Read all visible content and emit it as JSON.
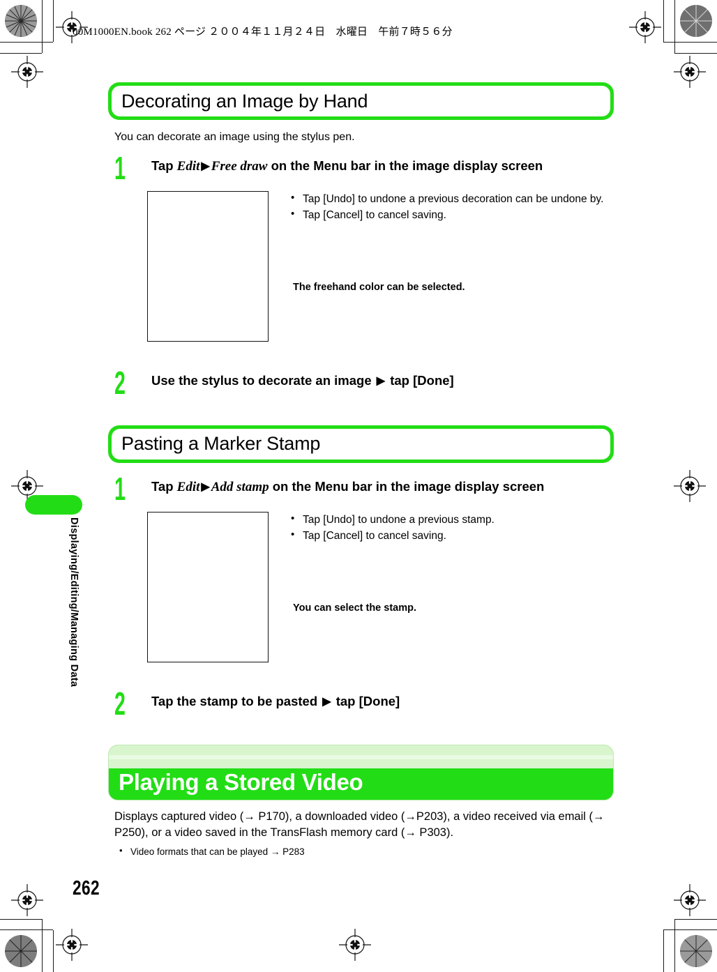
{
  "page": {
    "file_header": "00M1000EN.book   262 ページ   ２００４年１１月２４日　水曜日　午前７時５６分",
    "page_number": "262",
    "sidebar_label": "Displaying/Editing/Managing Data",
    "accent_green": "#22dd15",
    "light_green": "#d8f5ce"
  },
  "sections": [
    {
      "heading": "Decorating an Image by Hand",
      "intro": "You can decorate an image using the stylus pen.",
      "steps": [
        {
          "number": "1",
          "text_prefix": "Tap ",
          "italic_1": "Edit",
          "arrow": "▶",
          "italic_2": "Free draw",
          "text_suffix": " on the Menu bar in the image display screen"
        },
        {
          "number": "2",
          "text_prefix": "Use the stylus to decorate an image ",
          "arrow": "▶",
          "text_suffix": " tap [Done]"
        }
      ],
      "figure_notes": [
        "Tap [Undo] to undone a previous decoration can be undone by.",
        "Tap [Cancel] to cancel saving."
      ],
      "figure_caption": "The freehand color can be selected."
    },
    {
      "heading": "Pasting a Marker Stamp",
      "steps": [
        {
          "number": "1",
          "text_prefix": "Tap ",
          "italic_1": "Edit",
          "arrow": "▶",
          "italic_2": "Add stamp",
          "text_suffix": " on the Menu bar in the image display screen"
        },
        {
          "number": "2",
          "text_prefix": "Tap the stamp to be pasted ",
          "arrow": "▶",
          "text_suffix": " tap [Done]"
        }
      ],
      "figure_notes": [
        "Tap [Undo] to undone a previous stamp.",
        "Tap [Cancel] to cancel saving."
      ],
      "figure_caption": "You can select the stamp."
    }
  ],
  "chapter": {
    "banner_title": "Playing a Stored Video",
    "body": "Displays captured video (→ P170), a downloaded video (→P203), a video received via email (→ P250), or a video saved in the TransFlash memory card (→ P303).",
    "bullet": "Video formats that can be played → P283"
  }
}
